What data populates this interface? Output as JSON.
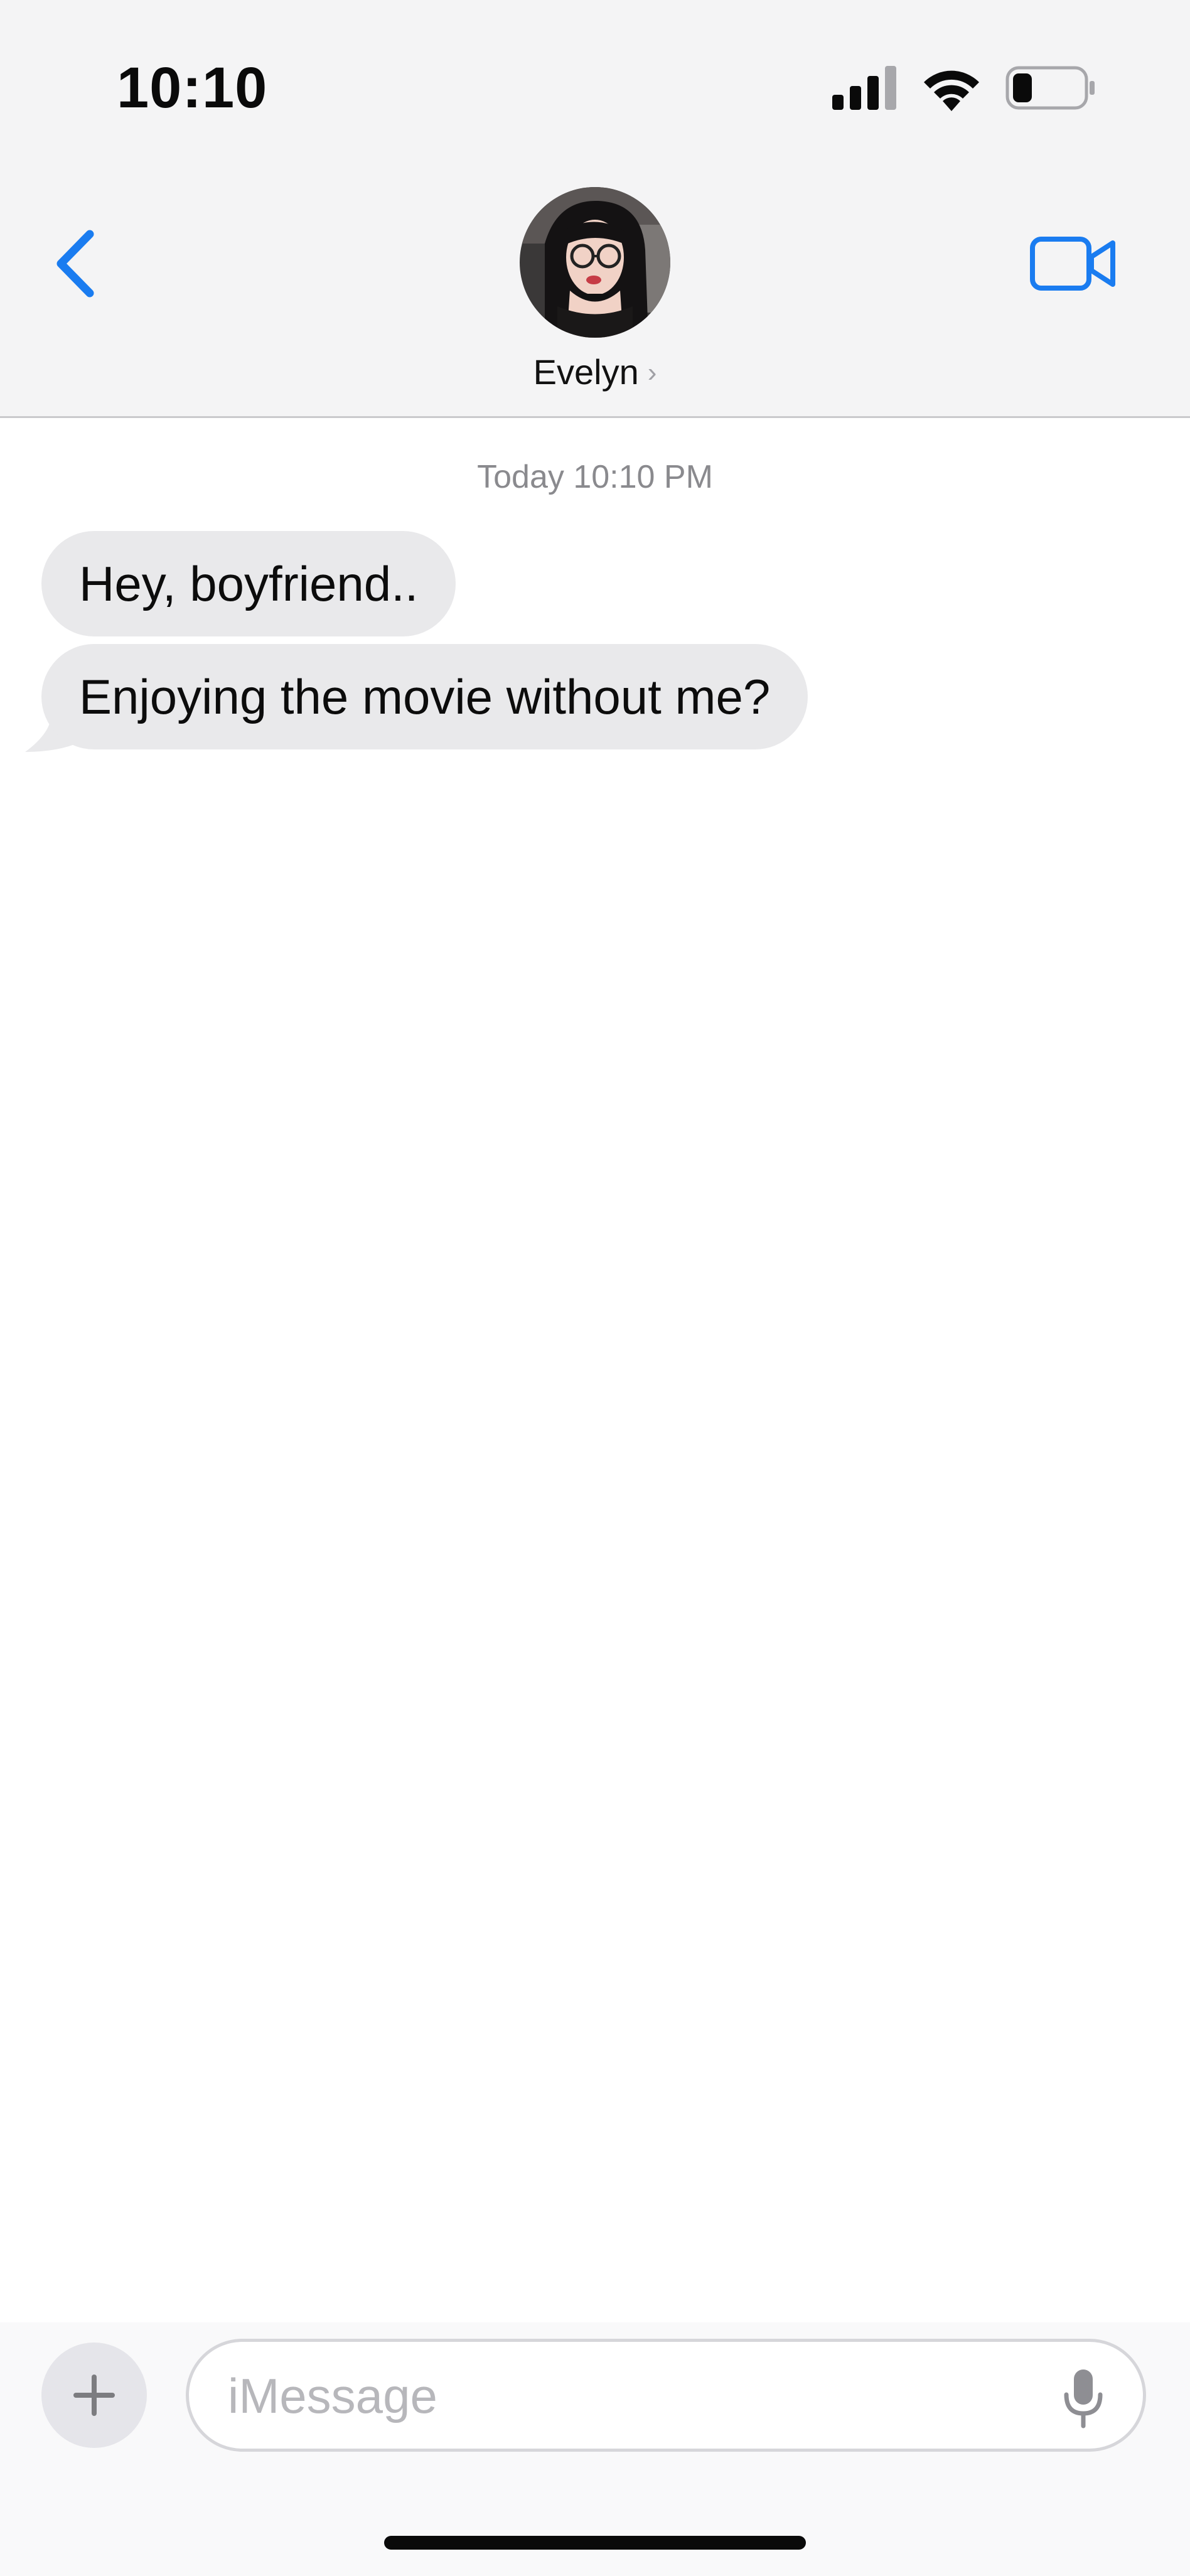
{
  "status_bar": {
    "time": "10:10",
    "icons": [
      "cellular-signal-icon",
      "wifi-icon",
      "battery-icon"
    ]
  },
  "nav": {
    "contact_name": "Evelyn",
    "chevron": "›",
    "icons": [
      "chevron-left-icon",
      "video-camera-icon"
    ]
  },
  "thread": {
    "timestamp": "Today 10:10 PM",
    "messages": [
      {
        "text": "Hey, boyfriend..",
        "direction": "incoming"
      },
      {
        "text": "Enjoying the movie without me?",
        "direction": "incoming"
      }
    ]
  },
  "composer": {
    "placeholder": "iMessage",
    "value": "",
    "plus_label": "+",
    "icons": [
      "plus-icon",
      "microphone-icon"
    ]
  },
  "colors": {
    "accent": "#1a7cf0",
    "header_bg": "#f4f4f5",
    "incoming_bubble": "#e9e9eb",
    "timestamp": "#8a8a8e"
  }
}
